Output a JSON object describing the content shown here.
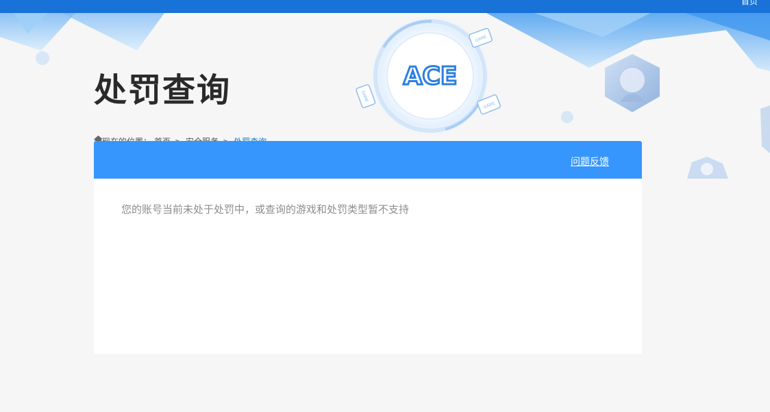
{
  "topbar": {
    "home_label": "首页"
  },
  "banner": {
    "title": "处罚查询",
    "logo_text": "ACE",
    "card_labels": [
      "GAME",
      "GAME",
      "GAME"
    ]
  },
  "breadcrumb": {
    "prefix": "您现在的位置：",
    "items": [
      "首页",
      "安全服务",
      "处罚查询"
    ],
    "separator": ">"
  },
  "panel": {
    "feedback_label": "问题反馈",
    "message": "您的账号当前未处于处罚中，或查询的游戏和处罚类型暂不支持"
  },
  "colors": {
    "topbar": "#1872d8",
    "panel_header": "#3696fd",
    "breadcrumb_current": "#1a79c7",
    "page_background": "#f6f6f6"
  },
  "icons": {
    "breadcrumb": "home-icon"
  }
}
